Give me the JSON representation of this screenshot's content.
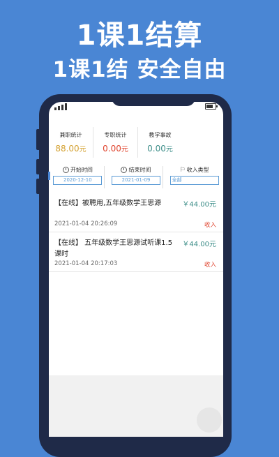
{
  "promo": {
    "headline": "1课1结算",
    "subheadline": "1课1结  安全自由"
  },
  "stats": [
    {
      "label": "兼职统计",
      "amount": "88.00",
      "unit": "元",
      "color": "#d4a233"
    },
    {
      "label": "专职统计",
      "amount": "0.00",
      "unit": "元",
      "color": "#e0442e"
    },
    {
      "label": "教学事故",
      "amount": "0.00",
      "unit": "元",
      "color": "#3f8f8a"
    }
  ],
  "filters": {
    "start": {
      "label": "开始时间",
      "value": "2020-12-10",
      "icon": "clock-icon"
    },
    "end": {
      "label": "结束时间",
      "value": "2021-01-09",
      "icon": "clock-icon"
    },
    "type": {
      "label": "收入类型",
      "value": "全部",
      "icon": "flag-icon"
    }
  },
  "records": [
    {
      "title": "【在线】被聘用,五年级数学王思源",
      "amount": "￥44.00元",
      "time": "2021-01-04 20:26:09",
      "type": "收入"
    },
    {
      "title": "【在线】 五年级数学王思源试听课1.5课时",
      "amount": "￥44.00元",
      "time": "2021-01-04 20:17:03",
      "type": "收入"
    }
  ]
}
